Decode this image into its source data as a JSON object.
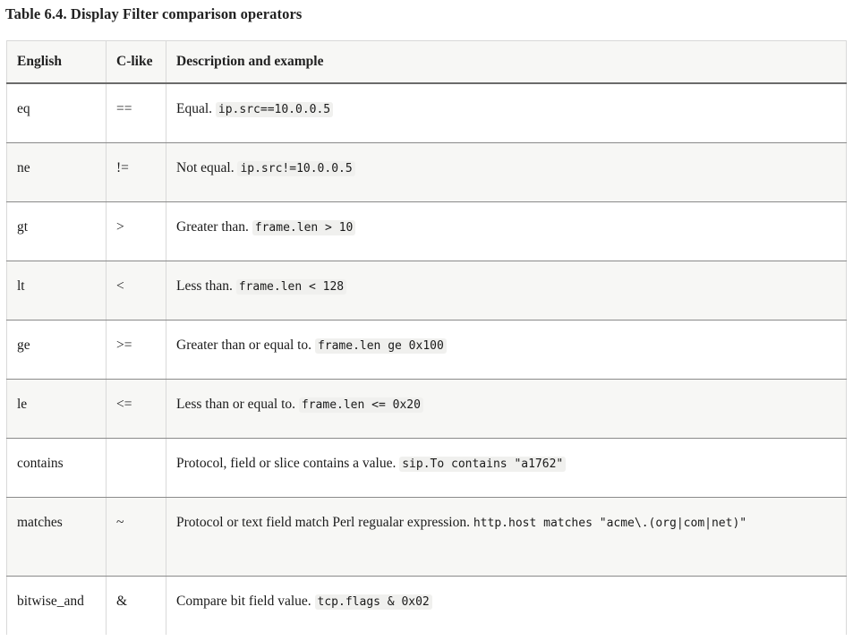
{
  "title": "Table 6.4. Display Filter comparison operators",
  "table": {
    "headers": {
      "english": "English",
      "clike": "C-like",
      "description": "Description and example"
    },
    "rows": [
      {
        "english": "eq",
        "clike": "==",
        "description": "Equal.",
        "example": "ip.src==10.0.0.5",
        "example_wrapped": "",
        "highlighted": true
      },
      {
        "english": "ne",
        "clike": "!=",
        "description": "Not equal.",
        "example": "ip.src!=10.0.0.5",
        "example_wrapped": "",
        "highlighted": true
      },
      {
        "english": "gt",
        "clike": ">",
        "description": "Greater than.",
        "example": "frame.len > 10",
        "example_wrapped": "",
        "highlighted": true
      },
      {
        "english": "lt",
        "clike": "<",
        "description": "Less than.",
        "example": "frame.len < 128",
        "example_wrapped": "",
        "highlighted": true
      },
      {
        "english": "ge",
        "clike": ">=",
        "description": "Greater than or equal to.",
        "example": "frame.len ge 0x100",
        "example_wrapped": "",
        "highlighted": true
      },
      {
        "english": "le",
        "clike": "<=",
        "description": "Less than or equal to.",
        "example": "frame.len <= 0x20",
        "example_wrapped": "",
        "highlighted": true
      },
      {
        "english": "contains",
        "clike": "",
        "description": "Protocol, field or slice contains a value.",
        "example": "sip.To contains \"a1762\"",
        "example_wrapped": "",
        "highlighted": true
      },
      {
        "english": "matches",
        "clike": "~",
        "description": "Protocol or text field match Perl regualar expression.",
        "example": "http.host matches \"acme\\.(org|com|net)\"",
        "example_wrapped": "yes",
        "highlighted": false
      },
      {
        "english": "bitwise_and",
        "clike": "&",
        "description": "Compare bit field value.",
        "example": "tcp.flags & 0x02",
        "example_wrapped": "",
        "highlighted": true
      }
    ]
  },
  "colors": {
    "page_background": "#ffffff",
    "header_background": "#f7f7f5",
    "zebra_row_background": "#f7f7f5",
    "code_background": "#f0f0ee",
    "grid_line": "#d9d9d9",
    "row_rule": "#8a8a8a",
    "header_rule": "#6b6b6b",
    "text": "#1a1a1a",
    "title_text": "#212121"
  }
}
